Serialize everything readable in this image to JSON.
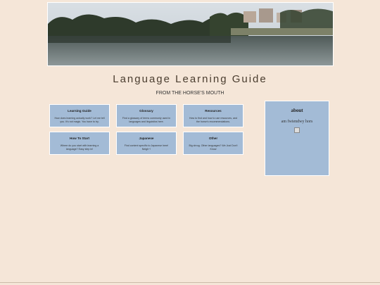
{
  "site": {
    "title": "Language Learning Guide",
    "tagline": "FROM THE HORSE'S MOUTH"
  },
  "cards": [
    {
      "title": "Learning Guide",
      "desc": "How does learning actually work? Let me tell you. It's not magic. You have to try."
    },
    {
      "title": "Glossary",
      "desc": "Find a glossary of terms commonly used in languages and linguistics here."
    },
    {
      "title": "Resources",
      "desc": "How to find and how to use resources, and the horse's recommendations."
    },
    {
      "title": "How To Start",
      "desc": "Where do you start with learning a language? Easy step in!"
    },
    {
      "title": "Japanese",
      "desc": "Find content specific to Japanese here! Neigh~!"
    },
    {
      "title": "Other",
      "desc": "Big shrug. Other languages? We Just Don't Know"
    }
  ],
  "about": {
    "title": "about",
    "body": "am fwiendwy hors",
    "image_icon": "broken-image-icon"
  }
}
